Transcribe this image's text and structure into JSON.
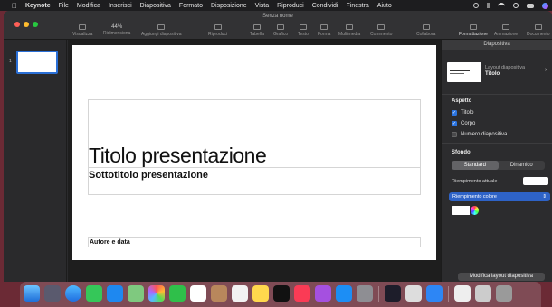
{
  "menubar": {
    "app": "Keynote",
    "items": [
      "File",
      "Modifica",
      "Inserisci",
      "Diapositiva",
      "Formato",
      "Disposizione",
      "Vista",
      "Riproduci",
      "Condividi",
      "Finestra",
      "Aiuto"
    ]
  },
  "window": {
    "title": "Senza nome"
  },
  "toolbar": {
    "zoom_value": "44%",
    "items": [
      "Visualizza",
      "Ridimensiona",
      "Aggiungi diapositiva",
      "Riproduci",
      "Tabella",
      "Grafico",
      "Testo",
      "Forma",
      "Multimedia",
      "Commento",
      "Collabora",
      "Formattazione",
      "Animazione",
      "Documento"
    ]
  },
  "navigator": {
    "slide_number": "1"
  },
  "slide": {
    "title": "Titolo presentazione",
    "subtitle": "Sottotitolo presentazione",
    "author": "Autore e data"
  },
  "inspector": {
    "header": "Diapositiva",
    "layout_label": "Layout diapositiva",
    "layout_value": "Titolo",
    "aspect_section": "Aspetto",
    "checkboxes": [
      {
        "label": "Titolo",
        "checked": true
      },
      {
        "label": "Corpo",
        "checked": true
      },
      {
        "label": "Numero diapositiva",
        "checked": false
      }
    ],
    "background_section": "Sfondo",
    "segments": [
      "Standard",
      "Dinamico"
    ],
    "current_fill_label": "Riempimento attuale",
    "fill_select": "Riempimento colore",
    "edit_layout_button": "Modifica layout diapositiva"
  },
  "colors": {
    "accent": "#2b74e0",
    "menubar": "#1d1d1f",
    "window": "#2b2b2d"
  }
}
